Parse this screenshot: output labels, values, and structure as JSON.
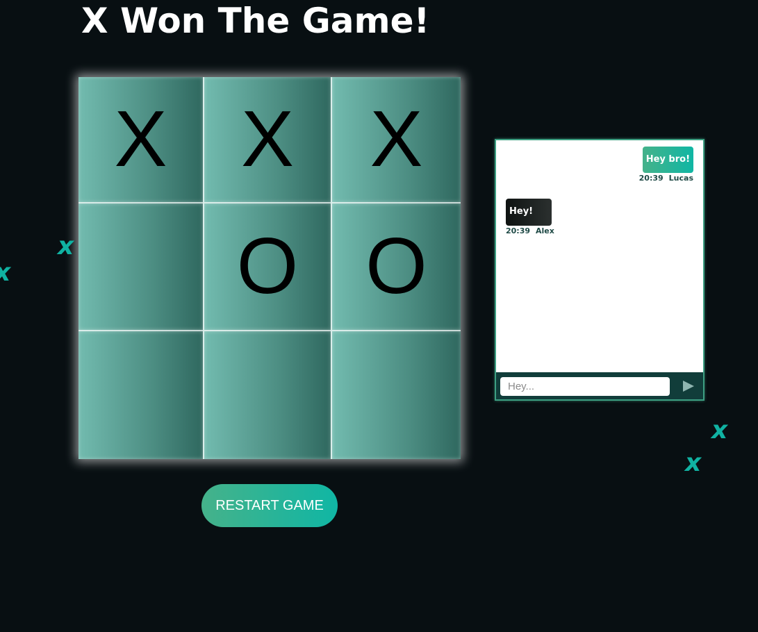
{
  "title": "X Won The Game!",
  "board": [
    [
      "X",
      "X",
      "X"
    ],
    [
      "",
      "O",
      "O"
    ],
    [
      "",
      "",
      ""
    ]
  ],
  "restart_label": "RESTART GAME",
  "chat": {
    "messages": [
      {
        "text": "Hey bro!",
        "time": "20:39",
        "author": "Lucas",
        "side": "right"
      },
      {
        "text": "Hey!",
        "time": "20:39",
        "author": "Alex",
        "side": "left"
      }
    ],
    "input_placeholder": "Hey...",
    "send_icon": "play-triangle-icon"
  },
  "decorations": [
    "x",
    "x",
    "x",
    "x"
  ],
  "colors": {
    "background": "#080f12",
    "accent": "#10b6a4",
    "accent_start": "#45b28a",
    "cell": "#4c8d82",
    "chat_bar": "#113d3a"
  }
}
